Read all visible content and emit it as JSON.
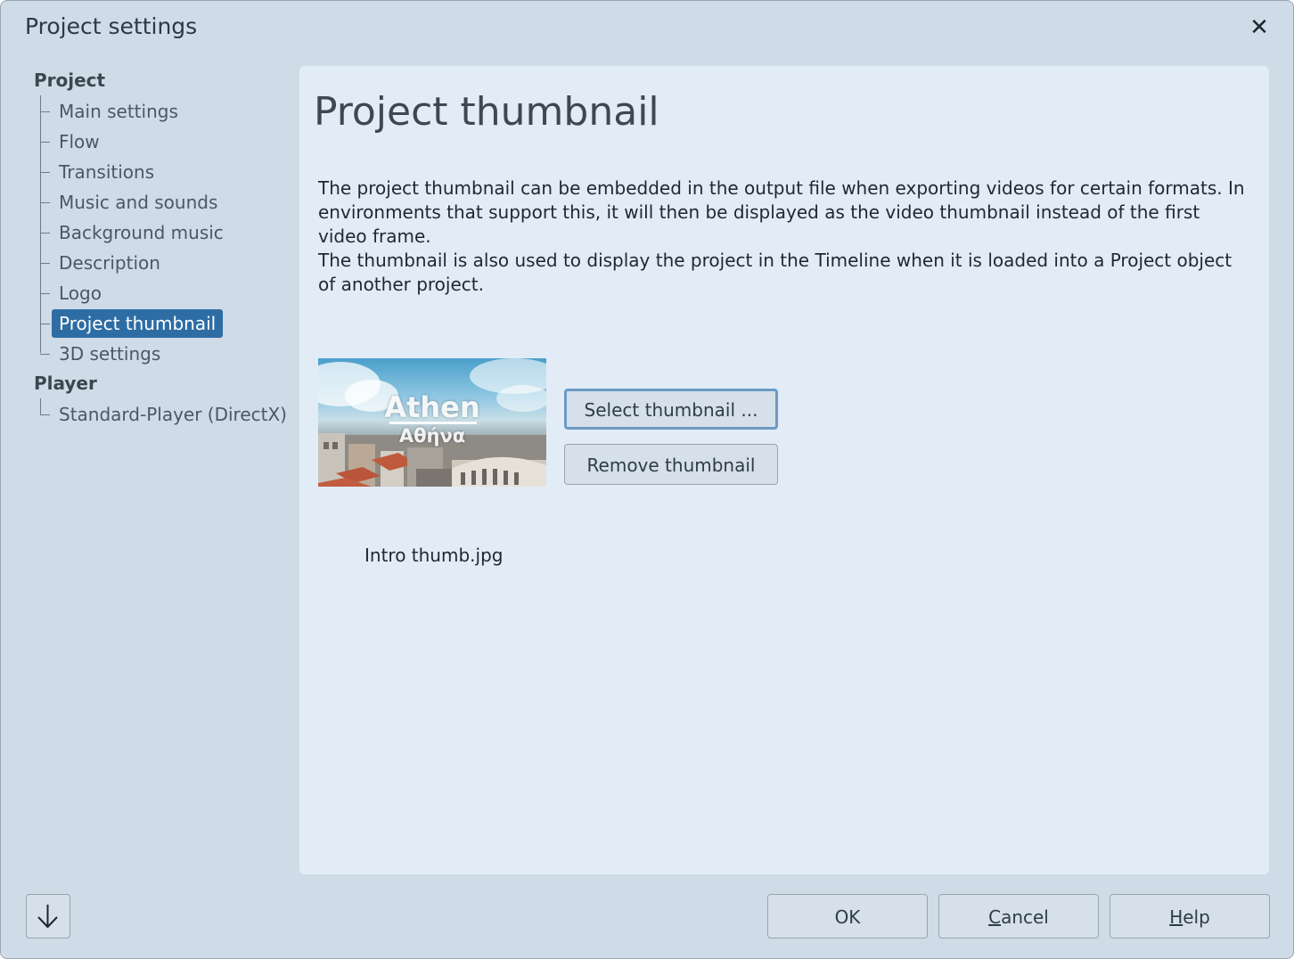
{
  "window": {
    "title": "Project settings"
  },
  "sidebar": {
    "groups": [
      {
        "label": "Project",
        "items": [
          "Main settings",
          "Flow",
          "Transitions",
          "Music and sounds",
          "Background music",
          "Description",
          "Logo",
          "Project thumbnail",
          "3D settings"
        ]
      },
      {
        "label": "Player",
        "items": [
          "Standard-Player (DirectX)"
        ]
      }
    ],
    "selected": "Project thumbnail"
  },
  "main": {
    "heading": "Project thumbnail",
    "description_1": "The project thumbnail can be embedded in the output file when exporting videos for certain formats. In environments that support this, it will then be displayed as the video thumbnail instead of the first video frame.",
    "description_2": "The thumbnail is also used to display the project in the Timeline when it is loaded into a Project object of another project.",
    "thumbnail": {
      "line1": "Athen",
      "line2": "Αθήνα"
    },
    "select_button": "Select thumbnail ...",
    "remove_button": "Remove thumbnail",
    "filename": "Intro thumb.jpg"
  },
  "footer": {
    "ok": "OK",
    "cancel_u": "C",
    "cancel_rest": "ancel",
    "help_u": "H",
    "help_rest": "elp"
  }
}
